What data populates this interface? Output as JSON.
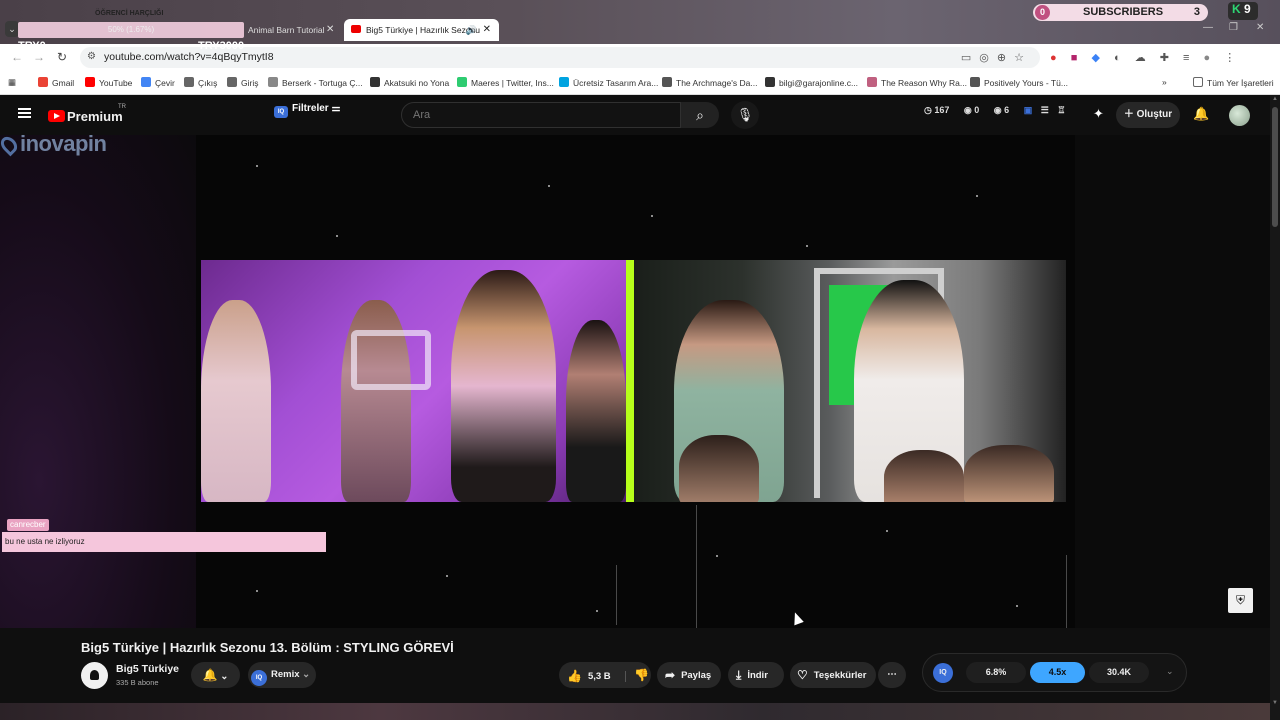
{
  "browser": {
    "overlay_title": "ÖĞRENCİ HARÇLIĞI",
    "overlay_progress": "50% (1.67%)",
    "tabs": [
      {
        "label": "Animal Barn Tutorial"
      },
      {
        "label": "Big5 Türkiye | Hazırlık Sezonu"
      }
    ],
    "url": "youtube.com/watch?v=4qBqyTmytI8",
    "widgets": {
      "subs_zero": "0",
      "subs_label": "SUBSCRIBERS",
      "subs_count": "3",
      "k_count": "9",
      "try0": "TRY0",
      "try3000": "TRY3000"
    },
    "bookmarks": [
      {
        "label": "Gmail",
        "color": "#ea4335"
      },
      {
        "label": "YouTube",
        "color": "#ff0000"
      },
      {
        "label": "Çevir",
        "color": "#4285f4"
      },
      {
        "label": "Çıkış",
        "color": "#666666"
      },
      {
        "label": "Giriş",
        "color": "#666666"
      },
      {
        "label": "Berserk - Tortuga Ç...",
        "color": "#888888"
      },
      {
        "label": "Akatsuki no Yona",
        "color": "#333333"
      },
      {
        "label": "Maeres | Twitter, Ins...",
        "color": "#2ecc71"
      },
      {
        "label": "Ücretsiz Tasarım Ara...",
        "color": "#00a3e0"
      },
      {
        "label": "The Archmage's Da...",
        "color": "#555555"
      },
      {
        "label": "bilgi@garajonline.c...",
        "color": "#333333"
      },
      {
        "label": "The Reason Why Ra...",
        "color": "#c06080"
      },
      {
        "label": "Positively Yours - Tü...",
        "color": "#555555"
      }
    ],
    "all_bookmarks": "Tüm Yer İşaretleri"
  },
  "youtube": {
    "logo": "Premium",
    "logo_region": "TR",
    "filters_label": "Filtreler",
    "search_placeholder": "Ara",
    "stats": {
      "time": "167",
      "views": "0",
      "eye": "6"
    },
    "create_label": "Oluştur",
    "watermark": "inovapin",
    "chat": {
      "user": "canrecber",
      "message": "bu ne usta ne izliyoruz"
    },
    "video_title": "Big5 Türkiye | Hazırlık Sezonu 13. Bölüm : STYLING GÖREVİ",
    "channel": {
      "name": "Big5 Türkiye",
      "subscribers": "335 B abone"
    },
    "actions": {
      "remix": "Remix",
      "likes": "5,3 B",
      "share": "Paylaş",
      "download": "İndir",
      "thanks": "Teşekkürler"
    },
    "iq_panel": {
      "badge": "IQ",
      "pct": "6.8%",
      "speed": "4.5x",
      "count": "30.4K"
    }
  },
  "colors": {
    "accent": "#ff0000",
    "iq_blue": "#3ea6ff",
    "stripe": "#b6ff1a"
  }
}
